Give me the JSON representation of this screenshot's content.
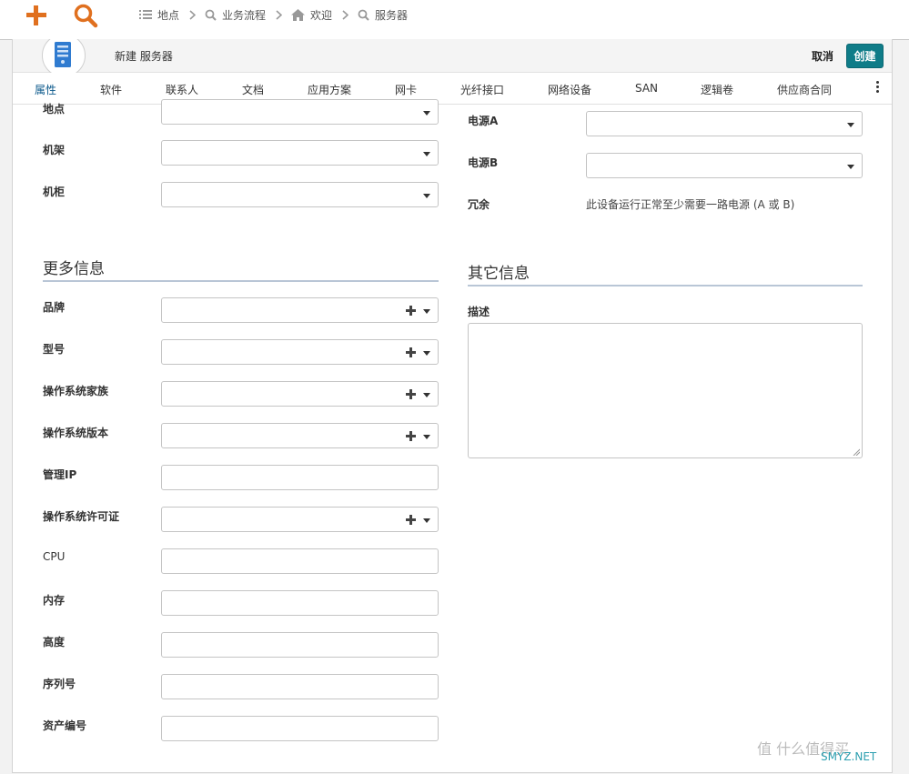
{
  "breadcrumbs": [
    {
      "label": "地点",
      "icon": "list-icon"
    },
    {
      "label": "业务流程",
      "icon": "search-icon"
    },
    {
      "label": "欢迎",
      "icon": "home-icon"
    },
    {
      "label": "服务器",
      "icon": "search-icon"
    }
  ],
  "header": {
    "title": "新建 服务器",
    "cancel_label": "取消",
    "create_label": "创建",
    "accent_color": "#0f7c88",
    "add_color": "#e0701f"
  },
  "tabs": [
    "属性",
    "软件",
    "联系人",
    "文档",
    "应用方案",
    "网卡",
    "光纤接口",
    "网络设备",
    "SAN",
    "逻辑卷",
    "供应商合同"
  ],
  "left_fields_top": [
    {
      "label": "地点",
      "type": "select",
      "value": ""
    },
    {
      "label": "机架",
      "type": "select",
      "value": ""
    },
    {
      "label": "机柜",
      "type": "select",
      "value": ""
    }
  ],
  "right_fields_top": [
    {
      "label": "电源A",
      "type": "select",
      "value": ""
    },
    {
      "label": "电源B",
      "type": "select",
      "value": ""
    },
    {
      "label": "冗余",
      "text": "此设备运行正常至少需要一路电源 (A 或 B)"
    }
  ],
  "more_info": {
    "title": "更多信息",
    "fields": [
      {
        "label": "品牌",
        "type": "select-add",
        "value": ""
      },
      {
        "label": "型号",
        "type": "select-add",
        "value": ""
      },
      {
        "label": "操作系统家族",
        "type": "select-add",
        "value": ""
      },
      {
        "label": "操作系统版本",
        "type": "select-add",
        "value": ""
      },
      {
        "label": "管理IP",
        "type": "text",
        "value": ""
      },
      {
        "label": "操作系统许可证",
        "type": "select-add",
        "value": ""
      },
      {
        "label": "CPU",
        "type": "text",
        "value": ""
      },
      {
        "label": "内存",
        "type": "text",
        "value": ""
      },
      {
        "label": "高度",
        "type": "text",
        "value": ""
      },
      {
        "label": "序列号",
        "type": "text",
        "value": ""
      },
      {
        "label": "资产编号",
        "type": "text",
        "value": ""
      }
    ]
  },
  "other_info": {
    "title": "其它信息",
    "description_label": "描述",
    "description_value": ""
  },
  "watermark": {
    "text": "值 什么值得买",
    "sub": "SMYZ.NET"
  }
}
